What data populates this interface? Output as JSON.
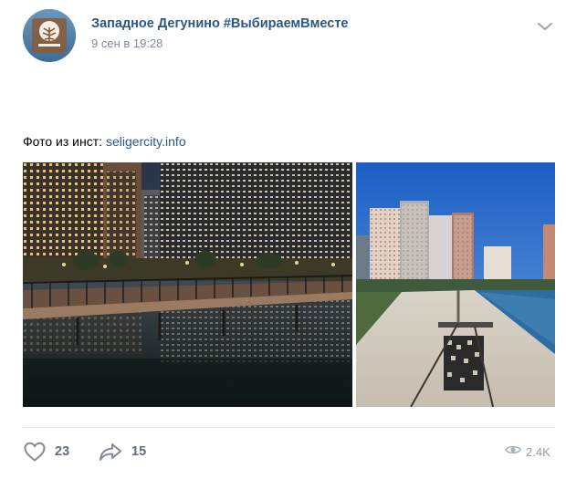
{
  "post": {
    "author": "Западное Дегунино #ВыбираемВместе",
    "date": "9 сен в 19:28",
    "text_prefix": "Фото из инст: ",
    "text_link": "seligercity.info"
  },
  "photos": [
    {
      "description": "evening-city-pond-with-boardwalk"
    },
    {
      "description": "daytime-residential-towers-and-embankment"
    }
  ],
  "footer": {
    "likes": "23",
    "shares": "15",
    "views": "2.4K"
  },
  "colors": {
    "author_link": "#2a5885",
    "meta_gray": "#818c99",
    "action_gray": "#626d7a",
    "divider": "#e7e8ec"
  },
  "icons": [
    "vk-avatar-logo",
    "chevron-down-icon",
    "heart-icon",
    "share-arrow-icon",
    "eye-icon"
  ]
}
